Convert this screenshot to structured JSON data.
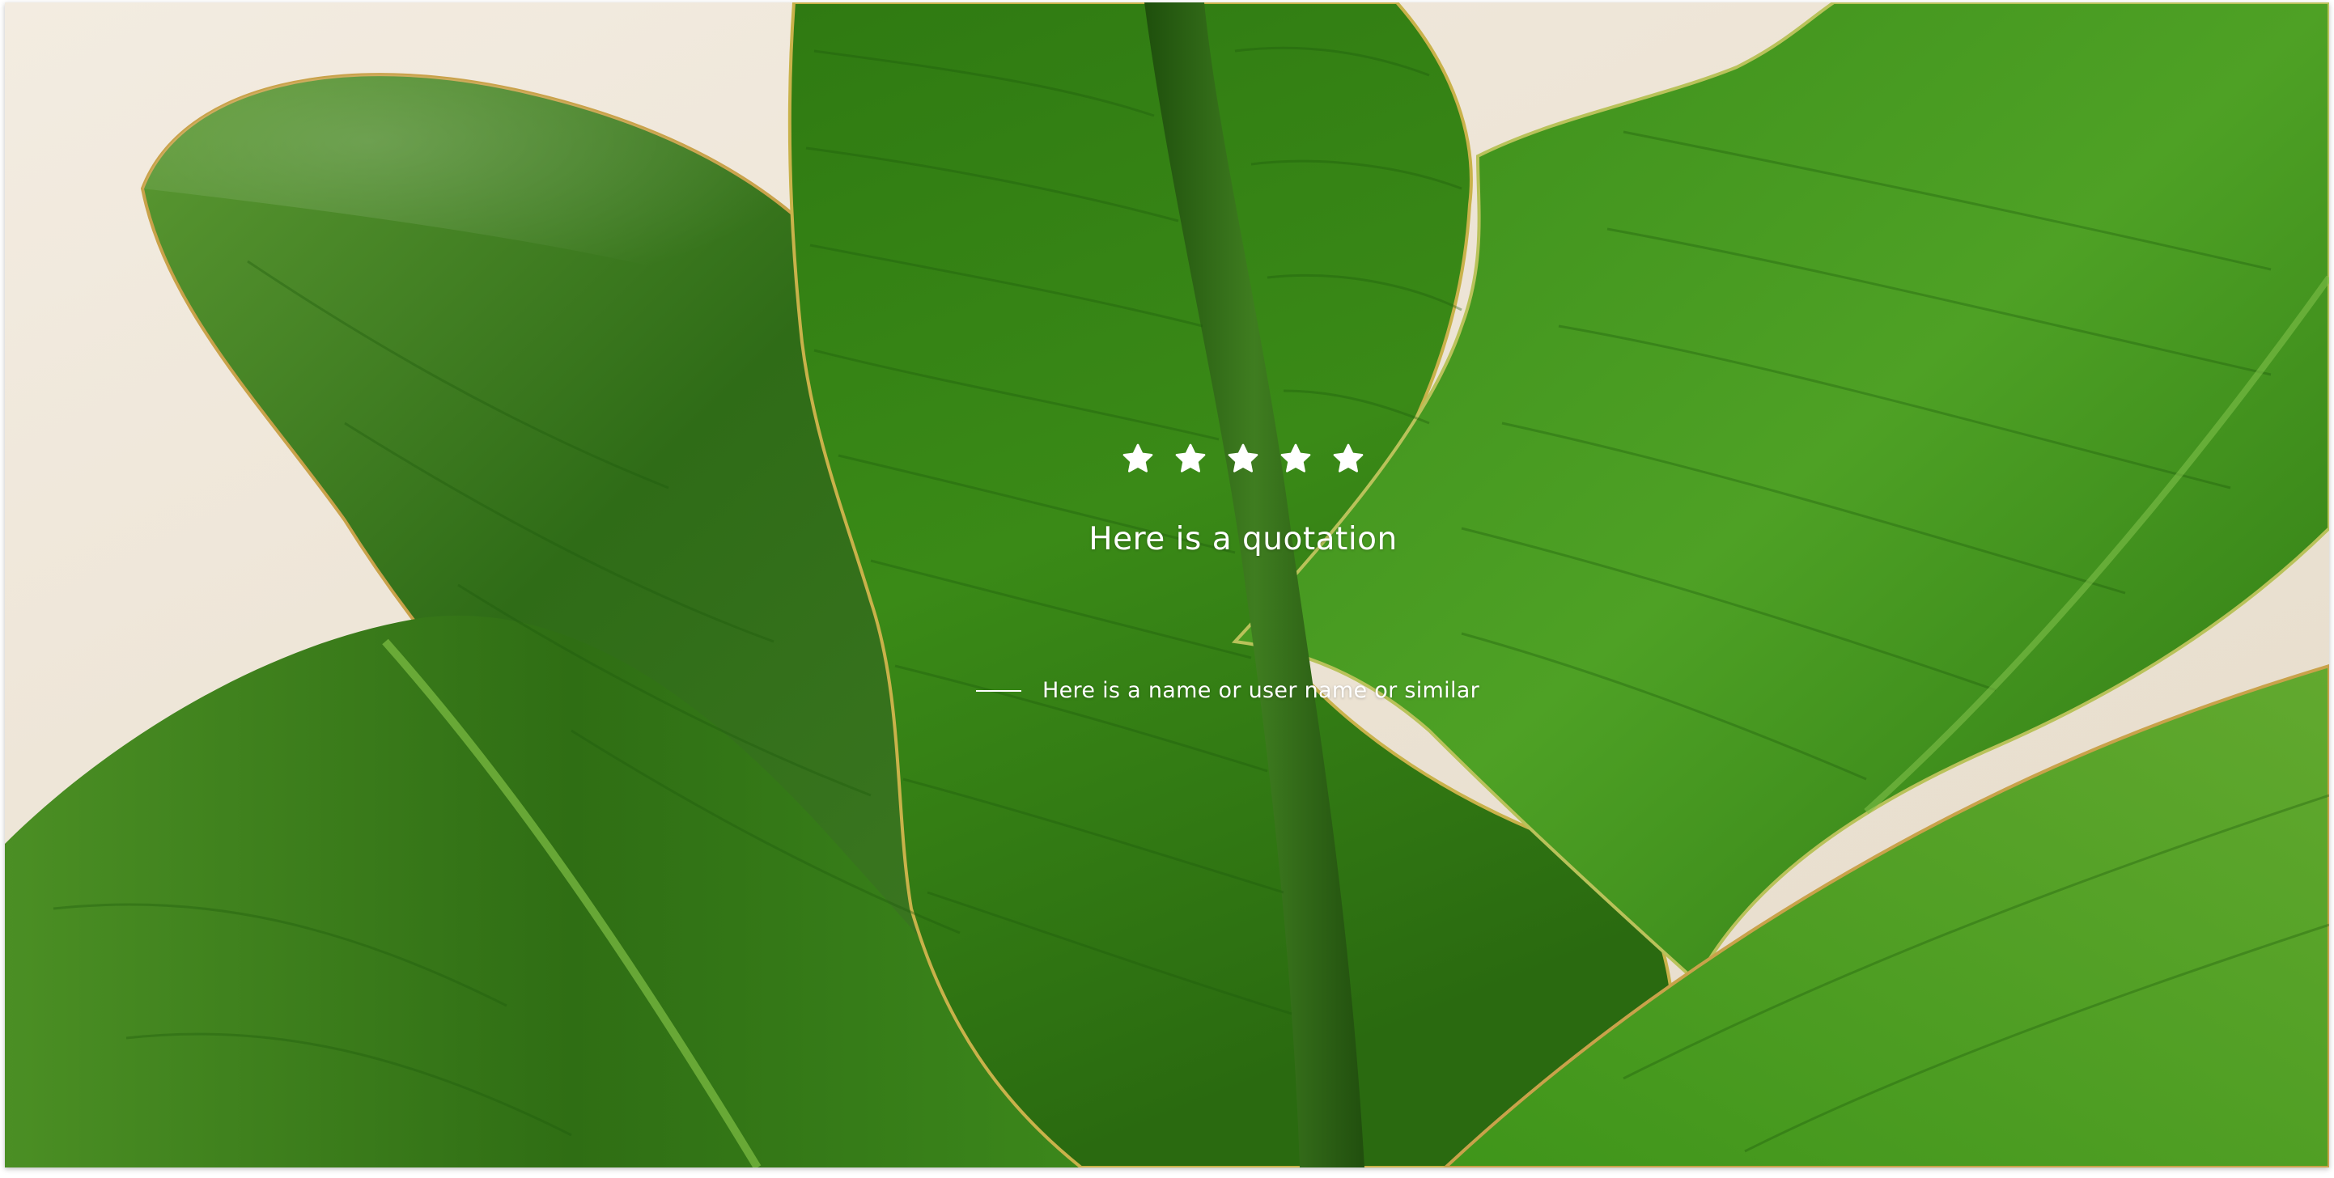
{
  "background": {
    "image": "tropical-leaves-photo",
    "colors": {
      "wall": "#efe7da",
      "leaf_dark": "#1f5a10",
      "leaf_mid": "#3d8a1c",
      "leaf_light": "#6fb335",
      "leaf_edge": "#c9a24a"
    }
  },
  "testimonial": {
    "rating": {
      "value": 5,
      "max": 5,
      "icon": "star-icon",
      "color": "#ffffff"
    },
    "quote": "Here is a quotation",
    "author": "Here is a name or user name or similar"
  }
}
